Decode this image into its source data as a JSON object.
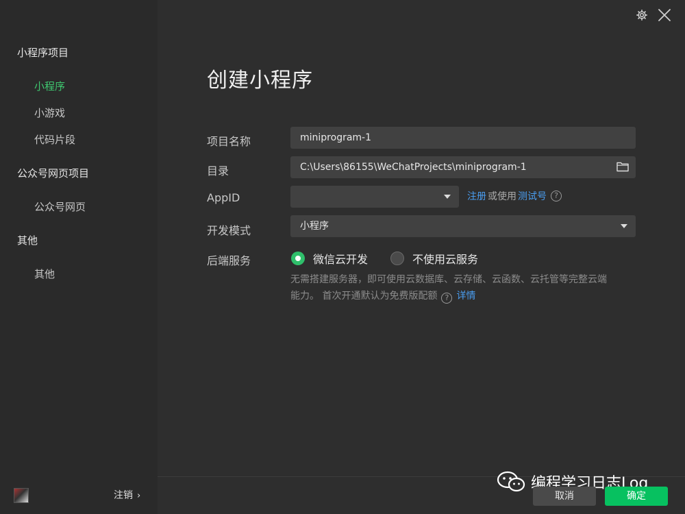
{
  "sidebar": {
    "groups": [
      {
        "title": "小程序项目",
        "items": [
          "小程序",
          "小游戏",
          "代码片段"
        ]
      },
      {
        "title": "公众号网页项目",
        "items": [
          "公众号网页"
        ]
      },
      {
        "title": "其他",
        "items": [
          "其他"
        ]
      }
    ],
    "active_item": "小程序",
    "logout_label": "注销",
    "logout_chevron": "›"
  },
  "header": {
    "title": "创建小程序",
    "icons": [
      "gear-icon",
      "close-icon"
    ]
  },
  "form": {
    "name_label": "项目名称",
    "name_value": "miniprogram-1",
    "dir_label": "目录",
    "dir_value": "C:\\Users\\86155\\WeChatProjects\\miniprogram-1",
    "appid_label": "AppID",
    "appid_value": "",
    "appid_register": "注册",
    "appid_or_use": "或使用",
    "appid_test": "测试号",
    "mode_label": "开发模式",
    "mode_value": "小程序",
    "backend_label": "后端服务",
    "backend_options": [
      "微信云开发",
      "不使用云服务"
    ],
    "backend_selected": 0,
    "desc_line1": "无需搭建服务器，即可使用云数据库、云存储、云函数、云托管等完整云端",
    "desc_line2": "能力。 首次开通默认为免费版配额",
    "desc_link": "详情",
    "help_glyph": "?"
  },
  "footer": {
    "cancel_label": "取消",
    "ok_label": "确定"
  },
  "watermark": {
    "text": "编程学习日志Log"
  },
  "colors": {
    "accent_green": "#07c160",
    "link_blue": "#4a9df0",
    "active_nav": "#3fc870"
  }
}
